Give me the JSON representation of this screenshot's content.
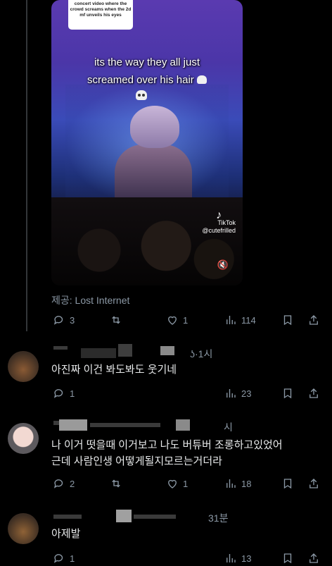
{
  "video": {
    "caption_box": "concert video where the crowd screams when the 2d mf unveils his eyes",
    "overlay_line1": "its the way they all just",
    "overlay_line2": "screamed over his hair",
    "watermark_brand": "TikTok",
    "watermark_handle": "@cutefrilled"
  },
  "post": {
    "credit": "제공: Lost Internet",
    "replies": "3",
    "likes": "1",
    "views": "114"
  },
  "replies": [
    {
      "meta_suffix": "ʖ·1시",
      "text": "아진짜 이건 봐도봐도 웃기네",
      "replies": "1",
      "views": "23"
    },
    {
      "meta_suffix": "시",
      "text_line1": "나 이거 떳을때 이거보고 나도 버튜버 조롱하고있었어",
      "text_line2": "근데 사람인생 어떻게될지모르는거더라",
      "replies": "2",
      "likes": "1",
      "views": "18"
    },
    {
      "meta_suffix": "31분",
      "text": "아제발",
      "replies": "1",
      "views": "13"
    }
  ],
  "icons": [
    "reply-icon",
    "repost-icon",
    "like-icon",
    "views-icon",
    "bookmark-icon",
    "share-icon",
    "skull-icon",
    "tiktok-icon",
    "mute-icon"
  ]
}
